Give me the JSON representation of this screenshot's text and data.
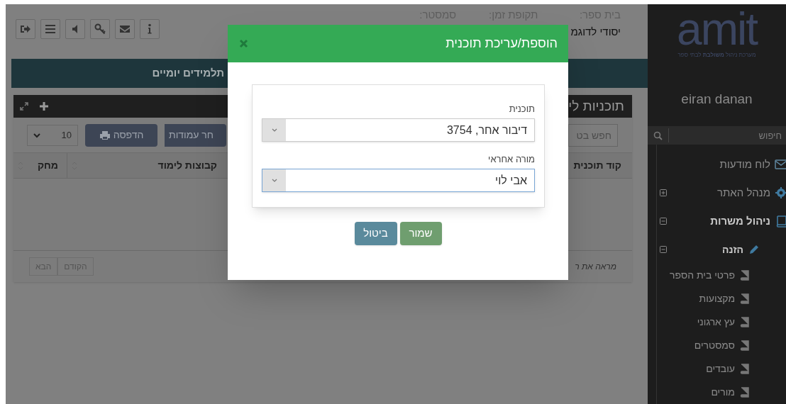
{
  "header": {
    "fields": [
      {
        "label": "בית ספר:",
        "value": "יסודי לדוגמ"
      },
      {
        "label": "תקופת זמן:"
      },
      {
        "label": "סמסטר:"
      }
    ]
  },
  "banner": "תלמידים יומיים",
  "panel": {
    "title": "תוכניות לי",
    "search": {
      "placeholder": "חפש בט"
    },
    "columns_button": "חר עמודות",
    "print_button": "הדפסה",
    "page_size": "10",
    "columns": [
      {
        "label": "קוד תוכנית"
      },
      {
        "label": "קבוצות לימוד"
      },
      {
        "label": "מחק"
      }
    ],
    "info": "מראה את ר",
    "pager": [
      "הקודם",
      "הבא"
    ]
  },
  "sidebar": {
    "logo": "amit",
    "tagline": "מערכת ניהול **משולבת** לבתי ספר",
    "user": "eiran danan",
    "search": {
      "placeholder": "חיפוש"
    },
    "items": [
      {
        "label": "לוח מודעות",
        "kind": "board",
        "bold": false
      },
      {
        "label": "מנהל האתר",
        "kind": "settings",
        "bold": false,
        "expanded": false
      },
      {
        "label": "ניהול משרות",
        "kind": "book",
        "bold": true,
        "expanded": true,
        "children": [
          {
            "label": "הזנה",
            "kind": "pencil",
            "bold": true,
            "expanded": true,
            "children": [
              {
                "label": "פרטי בית הספר",
                "kind": "page",
                "bold": false
              },
              {
                "label": "מקצועות",
                "kind": "page",
                "bold": false
              },
              {
                "label": "עץ ארגוני",
                "kind": "page",
                "bold": false
              },
              {
                "label": "סמסטרים",
                "kind": "page",
                "bold": false
              },
              {
                "label": "עובדים",
                "kind": "page",
                "bold": false
              },
              {
                "label": "מורים",
                "kind": "page",
                "bold": false
              }
            ]
          }
        ]
      }
    ]
  },
  "modal": {
    "title": "הוספת/עריכת תוכנית",
    "fields": [
      {
        "label": "תוכנית",
        "value": "דיבור אחר, 3754",
        "focused": false
      },
      {
        "label": "מורה אחראי",
        "value": "אבי לוי",
        "focused": true
      }
    ],
    "buttons": [
      {
        "label": "שמור",
        "kind": "save"
      },
      {
        "label": "ביטול",
        "kind": "cancel"
      }
    ]
  }
}
